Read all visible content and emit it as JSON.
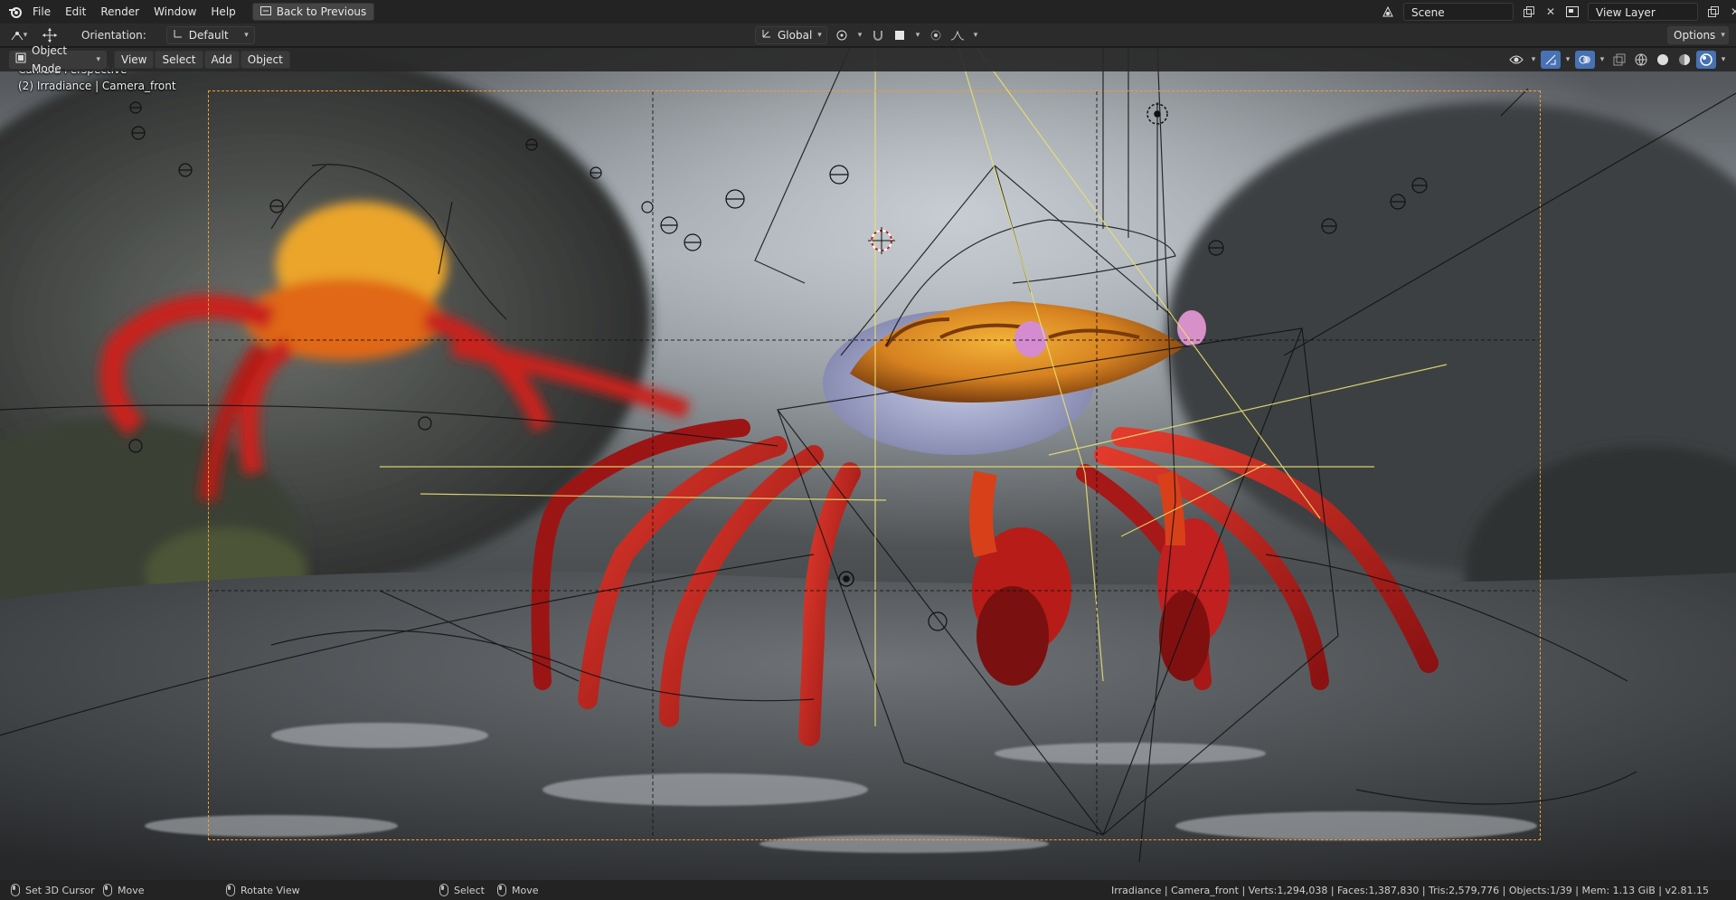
{
  "topbar": {
    "menus": [
      "File",
      "Edit",
      "Render",
      "Window",
      "Help"
    ],
    "back_button": "Back to Previous",
    "scene_field": "Scene",
    "view_layer_field": "View Layer"
  },
  "toolheader": {
    "orientation_label": "Orientation:",
    "orientation_value": "Default",
    "transform_space": "Global",
    "options_label": "Options"
  },
  "viewheader": {
    "mode": "Object Mode",
    "menus": [
      "View",
      "Select",
      "Add",
      "Object"
    ]
  },
  "viewport": {
    "perspective_label": "Camera Perspective",
    "object_label": "(2) Irradiance | Camera_front"
  },
  "statusbar": {
    "set_cursor": "Set 3D Cursor",
    "move_1": "Move",
    "rotate_view": "Rotate View",
    "select": "Select",
    "move_2": "Move",
    "stats": "Irradiance | Camera_front | Verts:1,294,038 | Faces:1,387,830 | Tris:2,579,776 | Objects:1/39 | Mem: 1.13 GiB | v2.81.15"
  },
  "colors": {
    "accent": "#4772b3",
    "camera_frame": "#f0a030",
    "crab_red": "#c0201e",
    "crab_orange": "#e08a1a"
  }
}
